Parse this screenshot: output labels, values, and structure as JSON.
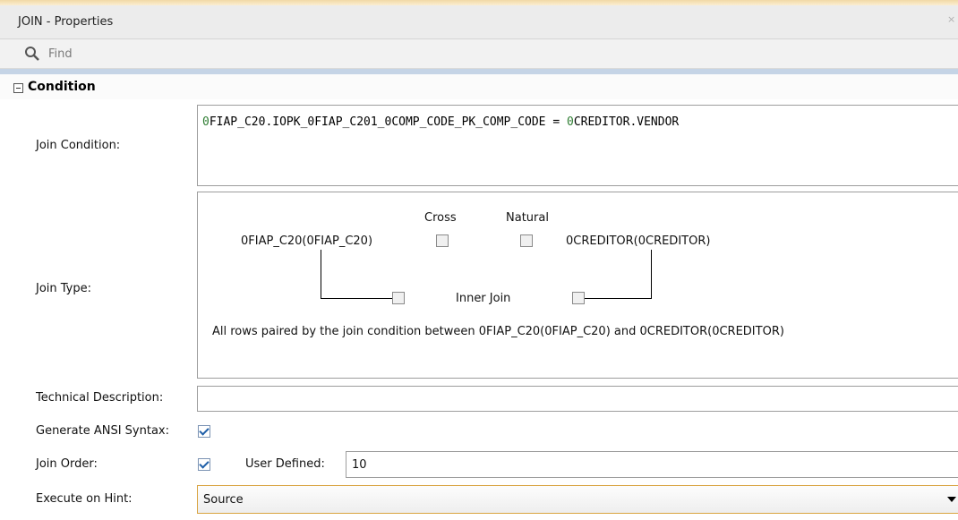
{
  "window": {
    "title": "JOIN - Properties",
    "close_glyph": "×"
  },
  "search": {
    "placeholder": "Find",
    "icon": "search-icon"
  },
  "section": {
    "title": "Condition",
    "expanded": true
  },
  "join_condition": {
    "label": "Join Condition:",
    "parts": [
      "0",
      "FIAP_C20.IOPK_0FIAP_C201_0COMP_CODE_PK_COMP_CODE = ",
      "0",
      "CREDITOR.VENDOR"
    ],
    "highlight_color": "#2e7d32"
  },
  "join_type": {
    "label": "Join Type:",
    "left_table": "0FIAP_C20(0FIAP_C20)",
    "right_table": "0CREDITOR(0CREDITOR)",
    "cross_label": "Cross",
    "natural_label": "Natural",
    "inner_join_label": "Inner Join",
    "description": "All rows paired by the join condition between 0FIAP_C20(0FIAP_C20) and 0CREDITOR(0CREDITOR)"
  },
  "technical_description": {
    "label": "Technical Description:",
    "value": ""
  },
  "generate_ansi": {
    "label": "Generate ANSI Syntax:",
    "checked": true
  },
  "join_order": {
    "label": "Join Order:",
    "checked": true,
    "user_defined_label": "User Defined:",
    "value": "10"
  },
  "execute_on_hint": {
    "label": "Execute on Hint:",
    "value": "Source"
  },
  "colors": {
    "accent": "#1f5fa8",
    "top_strip": "#f1d9a6",
    "separator": "#c5d4e6"
  }
}
